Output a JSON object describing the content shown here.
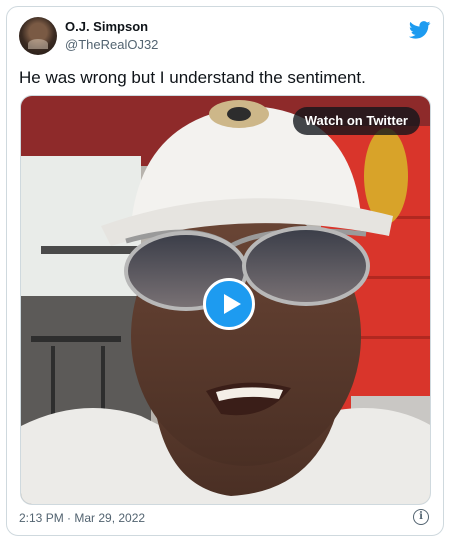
{
  "author": {
    "name": "O.J. Simpson",
    "handle": "@TheRealOJ32"
  },
  "tweet": {
    "text": "He was wrong but I understand the sentiment."
  },
  "media": {
    "watch_label": "Watch on Twitter",
    "play_icon": "play-icon"
  },
  "footer": {
    "timestamp": "2:13 PM · Mar 29, 2022",
    "info_glyph": "i"
  },
  "colors": {
    "twitter_blue": "#1d9bf0",
    "text": "#0f1419",
    "secondary_text": "#536471"
  }
}
